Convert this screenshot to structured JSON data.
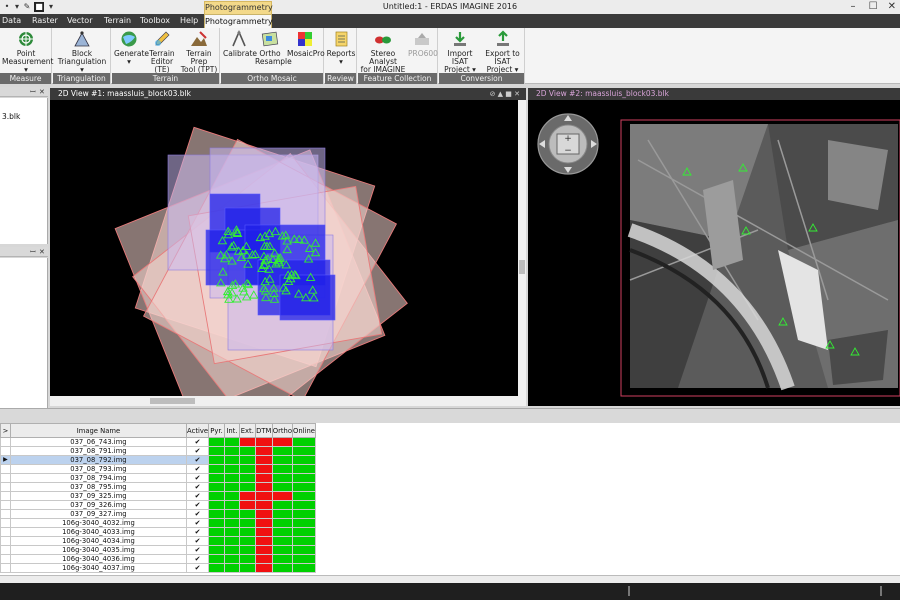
{
  "window": {
    "title": "Untitled:1 - ERDAS IMAGINE 2016",
    "context_tab_group": "Photogrammetry",
    "controls": [
      "–",
      "☐",
      "✕"
    ]
  },
  "menu": {
    "tabs": [
      "Data",
      "Raster",
      "Vector",
      "Terrain",
      "Toolbox",
      "Help",
      "Photogrammetry"
    ]
  },
  "ribbon": {
    "groups": [
      {
        "label": "Measure",
        "buttons": [
          {
            "label": "Point",
            "label2": "Measurement ▾"
          }
        ]
      },
      {
        "label": "Triangulation",
        "buttons": [
          {
            "label": "Block",
            "label2": "Triangulation ▾"
          }
        ]
      },
      {
        "label": "Terrain",
        "buttons": [
          {
            "label": "Generate",
            "label2": "▾"
          },
          {
            "label": "Terrain",
            "label2": "Editor (TE)"
          },
          {
            "label": "Terrain Prep",
            "label2": "Tool (TPT)"
          }
        ]
      },
      {
        "label": "Ortho Mosaic",
        "buttons": [
          {
            "label": "Calibrate",
            "label2": ""
          },
          {
            "label": "Ortho",
            "label2": "Resample"
          },
          {
            "label": "MosaicPro",
            "label2": ""
          }
        ]
      },
      {
        "label": "Review",
        "buttons": [
          {
            "label": "Reports",
            "label2": "▾"
          }
        ]
      },
      {
        "label": "Feature Collection",
        "buttons": [
          {
            "label": "Stereo Analyst",
            "label2": "for IMAGINE"
          },
          {
            "label": "PRO600",
            "label2": ""
          }
        ]
      },
      {
        "label": "Conversion",
        "buttons": [
          {
            "label": "Import ISAT",
            "label2": "Project ▾"
          },
          {
            "label": "Export to",
            "label2": "ISAT Project ▾"
          }
        ]
      }
    ]
  },
  "left_panel": {
    "item": "3.blk",
    "pin": "ꟷ",
    "close": "✕"
  },
  "views": {
    "view1": {
      "title": "2D View #1: maassluis_block03.blk"
    },
    "view2": {
      "title": "2D View #2: maassluis_block03.blk"
    }
  },
  "table": {
    "columns": [
      "Image Name",
      "Active",
      "Pyr.",
      "Int.",
      "Ext.",
      "DTM",
      "Ortho",
      "Online"
    ],
    "rows": [
      {
        "name": "037_06_743.img",
        "active": "✔",
        "status": [
          "g",
          "g",
          "r",
          "r",
          "r",
          "g"
        ]
      },
      {
        "name": "037_08_791.img",
        "active": "✔",
        "status": [
          "g",
          "g",
          "g",
          "r",
          "g",
          "g"
        ]
      },
      {
        "name": "037_08_792.img",
        "active": "✔",
        "status": [
          "g",
          "g",
          "g",
          "r",
          "g",
          "g"
        ],
        "selected": true
      },
      {
        "name": "037_08_793.img",
        "active": "✔",
        "status": [
          "g",
          "g",
          "g",
          "r",
          "g",
          "g"
        ]
      },
      {
        "name": "037_08_794.img",
        "active": "✔",
        "status": [
          "g",
          "g",
          "g",
          "r",
          "g",
          "g"
        ]
      },
      {
        "name": "037_08_795.img",
        "active": "✔",
        "status": [
          "g",
          "g",
          "g",
          "r",
          "g",
          "g"
        ]
      },
      {
        "name": "037_09_325.img",
        "active": "✔",
        "status": [
          "g",
          "g",
          "r",
          "r",
          "r",
          "g"
        ]
      },
      {
        "name": "037_09_326.img",
        "active": "✔",
        "status": [
          "g",
          "g",
          "r",
          "r",
          "g",
          "g"
        ]
      },
      {
        "name": "037_09_327.img",
        "active": "✔",
        "status": [
          "g",
          "g",
          "g",
          "r",
          "g",
          "g"
        ]
      },
      {
        "name": "106g-3040_4032.img",
        "active": "✔",
        "status": [
          "g",
          "g",
          "g",
          "r",
          "g",
          "g"
        ]
      },
      {
        "name": "106g-3040_4033.img",
        "active": "✔",
        "status": [
          "g",
          "g",
          "g",
          "r",
          "g",
          "g"
        ]
      },
      {
        "name": "106g-3040_4034.img",
        "active": "✔",
        "status": [
          "g",
          "g",
          "g",
          "r",
          "g",
          "g"
        ]
      },
      {
        "name": "106g-3040_4035.img",
        "active": "✔",
        "status": [
          "g",
          "g",
          "g",
          "r",
          "g",
          "g"
        ]
      },
      {
        "name": "106g-3040_4036.img",
        "active": "✔",
        "status": [
          "g",
          "g",
          "g",
          "r",
          "g",
          "g"
        ]
      },
      {
        "name": "106g-3040_4037.img",
        "active": "✔",
        "status": [
          "g",
          "g",
          "g",
          "r",
          "g",
          "g"
        ]
      }
    ]
  },
  "colors": {
    "ok": "#00d000",
    "fail": "#f01010",
    "gcp": "#33ee33",
    "view_bg": "#000000"
  }
}
